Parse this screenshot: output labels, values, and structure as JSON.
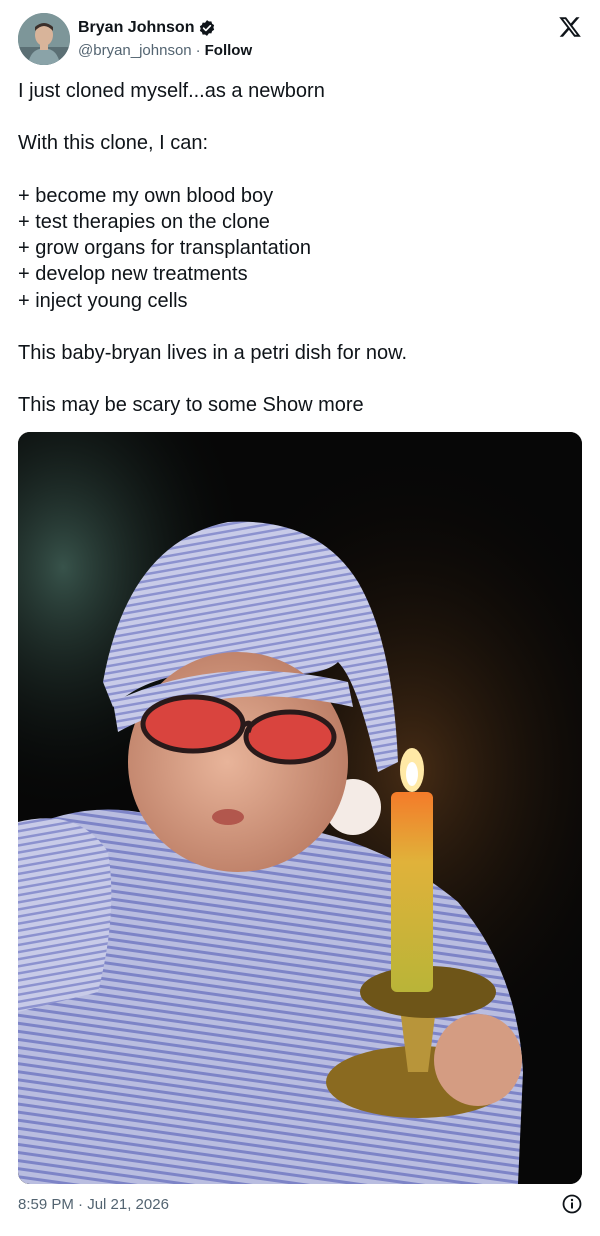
{
  "author": {
    "display_name": "Bryan Johnson",
    "handle": "@bryan_johnson",
    "separator": "·",
    "follow_label": "Follow",
    "verified_color": "#0f1419"
  },
  "icons": {
    "brand": "x-logo-icon",
    "verified": "verified-badge-icon",
    "info": "info-icon"
  },
  "tweet": {
    "lines": [
      "I just cloned myself...as a newborn",
      "With this clone, I can:",
      "+ become my own blood boy",
      "+ test therapies on the clone",
      "+ grow organs for transplantation",
      "+ develop new treatments",
      "+ inject young cells",
      "This baby-bryan lives in a petri dish for now.",
      "This may be scary to some"
    ],
    "show_more_label": "Show more"
  },
  "footer": {
    "timestamp": "8:59 PM · Jul 21, 2026"
  },
  "colors": {
    "text_primary": "#0f1419",
    "text_secondary": "#536471",
    "background": "#ffffff"
  }
}
